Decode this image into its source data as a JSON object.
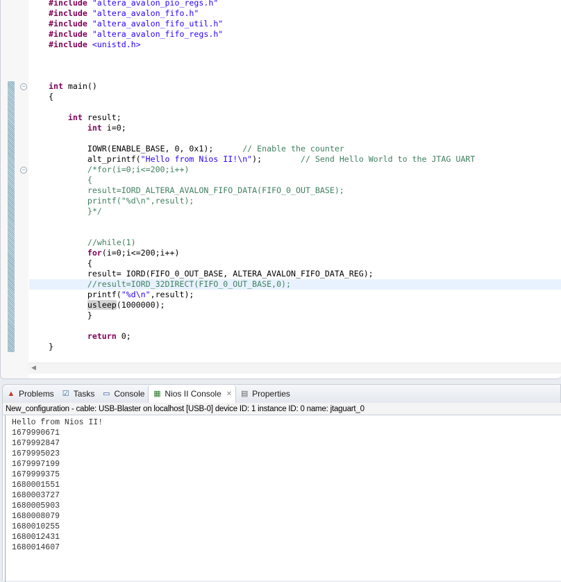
{
  "editor": {
    "lines": [
      [
        [
          "kw",
          "#include "
        ],
        [
          "str",
          "\"altera_avalon_pio_regs.h\""
        ]
      ],
      [
        [
          "kw",
          "#include "
        ],
        [
          "str",
          "\"altera_avalon_fifo.h\""
        ]
      ],
      [
        [
          "kw",
          "#include "
        ],
        [
          "str",
          "\"altera_avalon_fifo_util.h\""
        ]
      ],
      [
        [
          "kw",
          "#include "
        ],
        [
          "str",
          "\"altera_avalon_fifo_regs.h\""
        ]
      ],
      [
        [
          "kw",
          "#include "
        ],
        [
          "str",
          "<unistd.h>"
        ]
      ],
      [],
      [],
      [],
      [
        [
          "kw",
          "int "
        ],
        [
          "pl",
          "main()"
        ]
      ],
      [
        [
          "pl",
          "{"
        ]
      ],
      [],
      [
        [
          "pl",
          "    "
        ],
        [
          "kw",
          "int "
        ],
        [
          "pl",
          "result;"
        ]
      ],
      [
        [
          "pl",
          "        "
        ],
        [
          "kw",
          "int "
        ],
        [
          "pl",
          "i=0;"
        ]
      ],
      [],
      [
        [
          "pl",
          "        IOWR(ENABLE_BASE, 0, 0x1);      "
        ],
        [
          "cm",
          "// Enable the counter"
        ]
      ],
      [
        [
          "pl",
          "        alt_printf("
        ],
        [
          "str",
          "\"Hello from Nios II!\\n\""
        ],
        [
          "pl",
          ");        "
        ],
        [
          "cm",
          "// Send Hello World to the JTAG UART"
        ]
      ],
      [
        [
          "pl",
          "        "
        ],
        [
          "cm",
          "/*for(i=0;i<=200;i++)"
        ]
      ],
      [
        [
          "pl",
          "        "
        ],
        [
          "cm",
          "{"
        ]
      ],
      [
        [
          "pl",
          "        "
        ],
        [
          "cm",
          "result=IORD_ALTERA_AVALON_FIFO_DATA(FIFO_0_OUT_BASE);"
        ]
      ],
      [
        [
          "pl",
          "        "
        ],
        [
          "cm",
          "printf(\"%d\\n\",result);"
        ]
      ],
      [
        [
          "pl",
          "        "
        ],
        [
          "cm",
          "}*/"
        ]
      ],
      [],
      [],
      [
        [
          "pl",
          "        "
        ],
        [
          "cm",
          "//while(1)"
        ]
      ],
      [
        [
          "pl",
          "        "
        ],
        [
          "kw",
          "for"
        ],
        [
          "pl",
          "(i=0;i<=200;i++)"
        ]
      ],
      [
        [
          "pl",
          "        {"
        ]
      ],
      [
        [
          "pl",
          "        result= IORD(FIFO_0_OUT_BASE, ALTERA_AVALON_FIFO_DATA_REG);"
        ]
      ],
      [
        [
          "pl",
          "        "
        ],
        [
          "cm",
          "//result=IORD_32DIRECT(FIFO_0_OUT_BASE,0);"
        ]
      ],
      [
        [
          "pl",
          "        printf("
        ],
        [
          "str",
          "\"%d\\n\""
        ],
        [
          "pl",
          ",result);"
        ]
      ],
      [
        [
          "pl",
          "        "
        ],
        [
          "mark",
          "usleep"
        ],
        [
          "pl",
          "(1000000);"
        ]
      ],
      [
        [
          "pl",
          "        }"
        ]
      ],
      [],
      [
        [
          "pl",
          "        "
        ],
        [
          "kw",
          "return "
        ],
        [
          "pl",
          "0;"
        ]
      ],
      [
        [
          "pl",
          "}"
        ]
      ]
    ]
  },
  "tabs": [
    {
      "label": "Problems",
      "icon": "problems-icon"
    },
    {
      "label": "Tasks",
      "icon": "tasks-icon"
    },
    {
      "label": "Console",
      "icon": "console-icon"
    },
    {
      "label": "Nios II Console",
      "icon": "nios-console-icon",
      "active": true
    },
    {
      "label": "Properties",
      "icon": "properties-icon"
    }
  ],
  "console": {
    "config": "New_configuration - cable: USB-Blaster on localhost [USB-0] device ID: 1 instance ID: 0 name: jtaguart_0",
    "output": [
      "Hello from Nios II!",
      "1679990671",
      "1679992847",
      "1679995023",
      "1679997199",
      "1679999375",
      "1680001551",
      "1680003727",
      "1680005903",
      "1680008079",
      "1680010255",
      "1680012431",
      "1680014607"
    ]
  }
}
